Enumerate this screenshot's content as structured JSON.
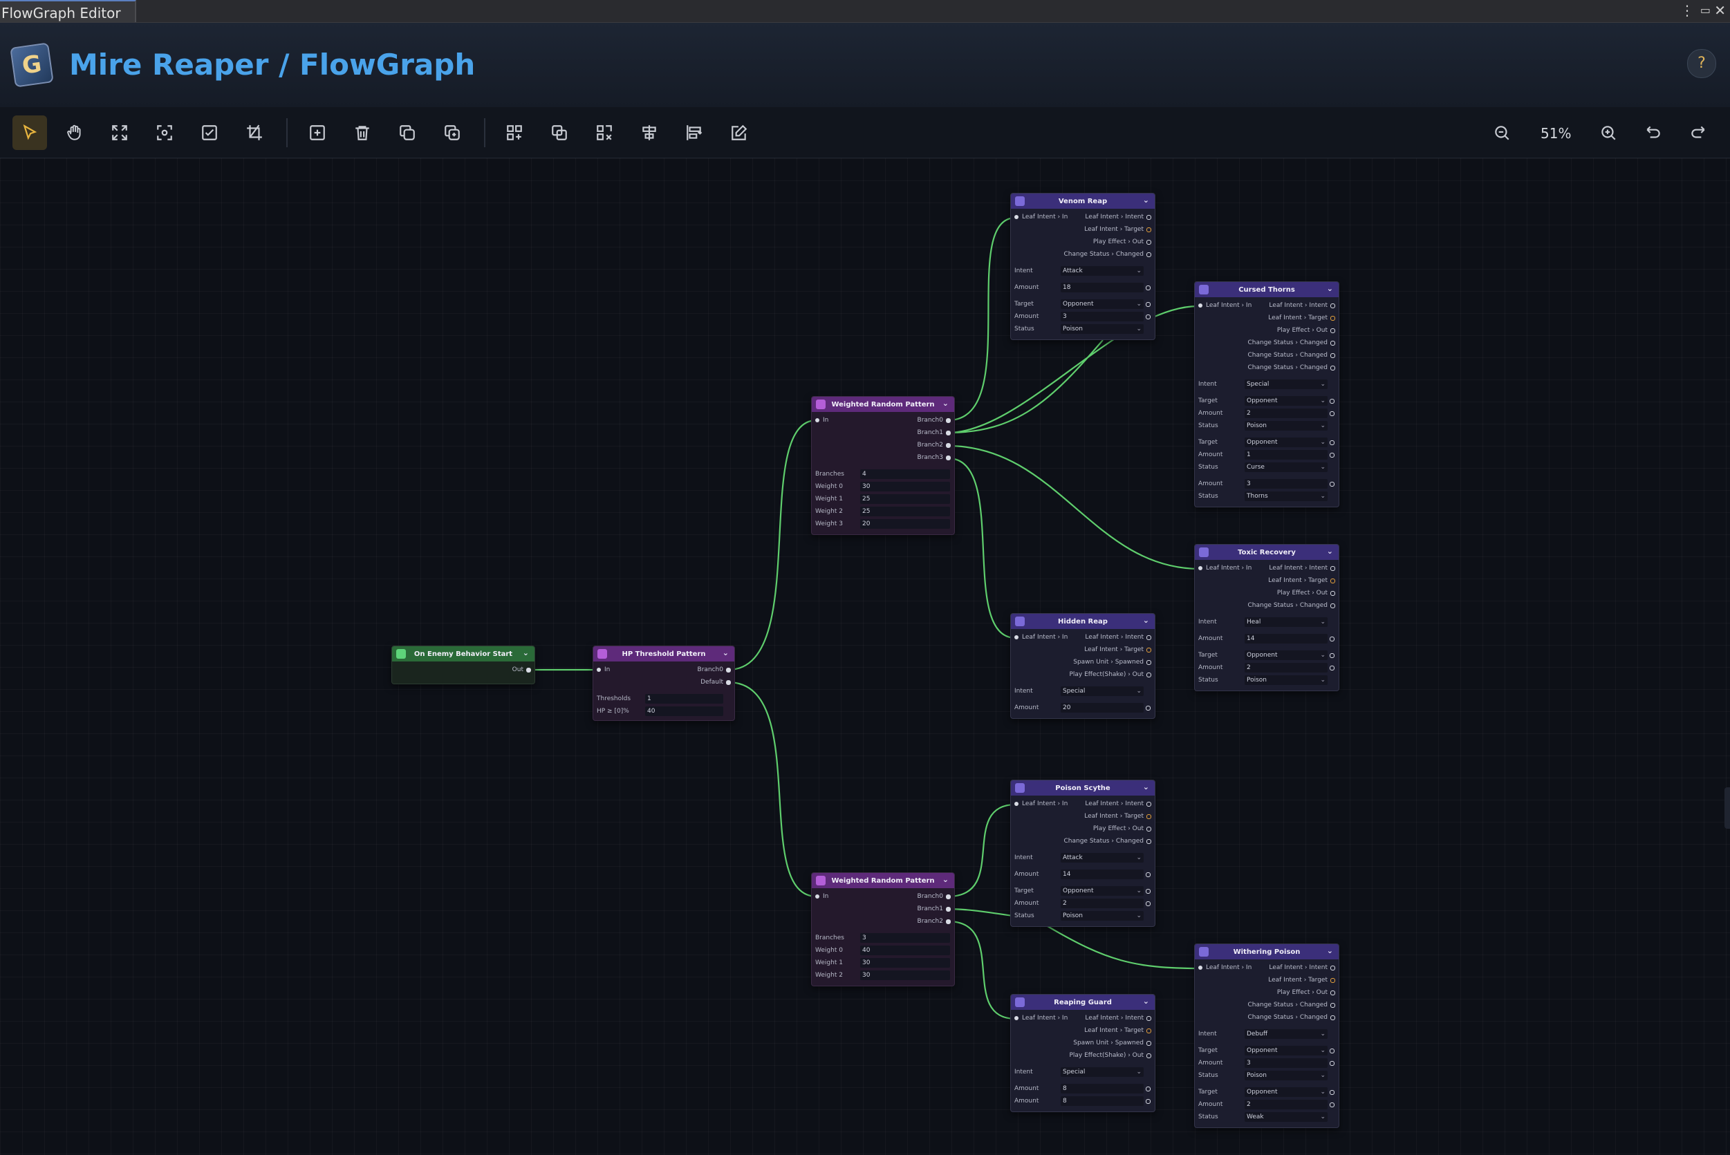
{
  "window": {
    "tab_title": "FlowGraph Editor"
  },
  "header": {
    "title": "Mire Reaper / FlowGraph",
    "help_label": "?"
  },
  "toolbar": {
    "zoom_level": "51%"
  },
  "nodes": {
    "start": {
      "title": "On Enemy Behavior Start",
      "out": "Out"
    },
    "hp": {
      "title": "HP Threshold Pattern",
      "in": "In",
      "branch0": "Branch0",
      "default": "Default",
      "f1_label": "Thresholds",
      "f1_value": "1",
      "f2_label": "HP ≥ [0]%",
      "f2_value": "40"
    },
    "wrp1": {
      "title": "Weighted Random Pattern",
      "in": "In",
      "outs": [
        "Branch0",
        "Branch1",
        "Branch2",
        "Branch3"
      ],
      "fields": [
        [
          "Branches",
          "4"
        ],
        [
          "Weight 0",
          "30"
        ],
        [
          "Weight 1",
          "25"
        ],
        [
          "Weight 2",
          "25"
        ],
        [
          "Weight 3",
          "20"
        ]
      ]
    },
    "wrp2": {
      "title": "Weighted Random Pattern",
      "in": "In",
      "outs": [
        "Branch0",
        "Branch1",
        "Branch2"
      ],
      "fields": [
        [
          "Branches",
          "3"
        ],
        [
          "Weight 0",
          "40"
        ],
        [
          "Weight 1",
          "30"
        ],
        [
          "Weight 2",
          "30"
        ]
      ]
    },
    "venom": {
      "title": "Venom Reap",
      "in": "Leaf Intent › In",
      "outs": [
        "Leaf Intent › Intent",
        "Leaf Intent › Target",
        "Play Effect › Out",
        "Change Status › Changed"
      ],
      "fields": [
        [
          "Intent",
          "Attack"
        ],
        [
          "Amount",
          "18"
        ],
        [
          "Target",
          "Opponent"
        ],
        [
          "Amount",
          "3"
        ],
        [
          "Status",
          "Poison"
        ]
      ]
    },
    "cursed": {
      "title": "Cursed Thorns",
      "in": "Leaf Intent › In",
      "outs": [
        "Leaf Intent › Intent",
        "Leaf Intent › Target",
        "Play Effect › Out",
        "Change Status › Changed",
        "Change Status › Changed",
        "Change Status › Changed"
      ],
      "fields": [
        [
          "Intent",
          "Special"
        ],
        [
          "Target",
          "Opponent"
        ],
        [
          "Amount",
          "2"
        ],
        [
          "Status",
          "Poison"
        ],
        [
          "Target",
          "Opponent"
        ],
        [
          "Amount",
          "1"
        ],
        [
          "Status",
          "Curse"
        ],
        [
          "Amount",
          "3"
        ],
        [
          "Status",
          "Thorns"
        ]
      ]
    },
    "toxic": {
      "title": "Toxic Recovery",
      "in": "Leaf Intent › In",
      "outs": [
        "Leaf Intent › Intent",
        "Leaf Intent › Target",
        "Play Effect › Out",
        "Change Status › Changed"
      ],
      "fields": [
        [
          "Intent",
          "Heal"
        ],
        [
          "Amount",
          "14"
        ],
        [
          "Target",
          "Opponent"
        ],
        [
          "Amount",
          "2"
        ],
        [
          "Status",
          "Poison"
        ]
      ]
    },
    "hidden": {
      "title": "Hidden Reap",
      "in": "Leaf Intent › In",
      "outs": [
        "Leaf Intent › Intent",
        "Leaf Intent › Target",
        "Spawn Unit › Spawned",
        "Play Effect(Shake) › Out"
      ],
      "fields": [
        [
          "Intent",
          "Special"
        ],
        [
          "Amount",
          "20"
        ]
      ]
    },
    "scythe": {
      "title": "Poison Scythe",
      "in": "Leaf Intent › In",
      "outs": [
        "Leaf Intent › Intent",
        "Leaf Intent › Target",
        "Play Effect › Out",
        "Change Status › Changed"
      ],
      "fields": [
        [
          "Intent",
          "Attack"
        ],
        [
          "Amount",
          "14"
        ],
        [
          "Target",
          "Opponent"
        ],
        [
          "Amount",
          "2"
        ],
        [
          "Status",
          "Poison"
        ]
      ]
    },
    "withering": {
      "title": "Withering Poison",
      "in": "Leaf Intent › In",
      "outs": [
        "Leaf Intent › Intent",
        "Leaf Intent › Target",
        "Play Effect › Out",
        "Change Status › Changed",
        "Change Status › Changed"
      ],
      "fields": [
        [
          "Intent",
          "Debuff"
        ],
        [
          "Target",
          "Opponent"
        ],
        [
          "Amount",
          "3"
        ],
        [
          "Status",
          "Poison"
        ],
        [
          "Target",
          "Opponent"
        ],
        [
          "Amount",
          "2"
        ],
        [
          "Status",
          "Weak"
        ]
      ]
    },
    "guard": {
      "title": "Reaping Guard",
      "in": "Leaf Intent › In",
      "outs": [
        "Leaf Intent › Intent",
        "Leaf Intent › Target",
        "Spawn Unit › Spawned",
        "Play Effect(Shake) › Out"
      ],
      "fields": [
        [
          "Intent",
          "Special"
        ],
        [
          "Amount",
          "8"
        ],
        [
          "Amount",
          "8"
        ]
      ]
    }
  },
  "colors": {
    "wire": "#5fce6d",
    "accent": "#4aa3ea",
    "active_tool": "#e8b53f"
  }
}
